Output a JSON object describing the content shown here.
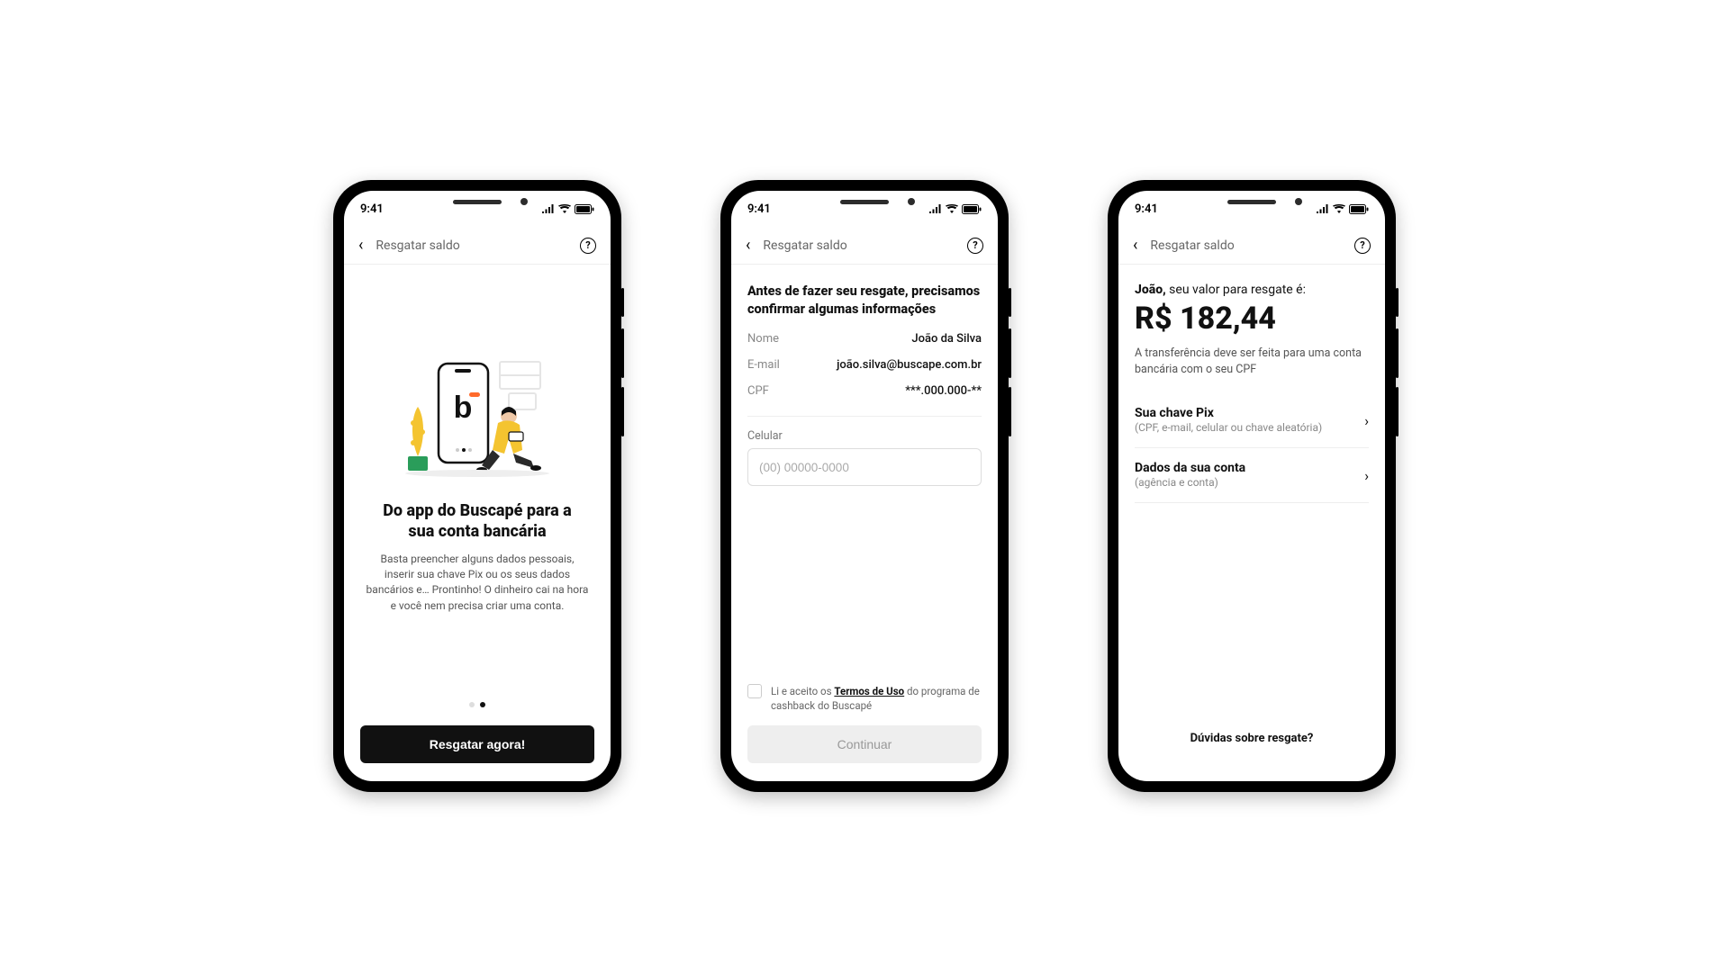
{
  "status": {
    "time": "9:41"
  },
  "nav": {
    "title": "Resgatar saldo"
  },
  "screen1": {
    "heading": "Do app do Buscapé para a sua conta bancária",
    "body": "Basta preencher alguns dados pessoais, inserir sua chave Pix ou os seus dados bancários e… Prontinho! O dinheiro cai na hora e você nem precisa criar uma conta.",
    "cta": "Resgatar agora!"
  },
  "screen2": {
    "heading": "Antes de fazer seu resgate, precisamos confirmar algumas informações",
    "rows": {
      "name_label": "Nome",
      "name_value": "João da Silva",
      "email_label": "E-mail",
      "email_value": "joão.silva@buscape.com.br",
      "cpf_label": "CPF",
      "cpf_value": "***.000.000-**"
    },
    "phone_label": "Celular",
    "phone_placeholder": "(00) 00000-0000",
    "terms_prefix": "Li e aceito os ",
    "terms_link": "Termos de Uso",
    "terms_suffix": " do programa de cashback do Buscapé",
    "cta": "Continuar"
  },
  "screen3": {
    "greet_name": "João,",
    "greet_rest": " seu valor para resgate é:",
    "amount": "R$ 182,44",
    "note": "A transferência deve ser feita para uma conta bancária com o seu CPF",
    "option_pix_title": "Sua chave Pix",
    "option_pix_sub": "(CPF, e-mail, celular ou chave aleatória)",
    "option_bank_title": "Dados da sua conta",
    "option_bank_sub": "(agência e conta)",
    "help": "Dúvidas sobre resgate?"
  }
}
